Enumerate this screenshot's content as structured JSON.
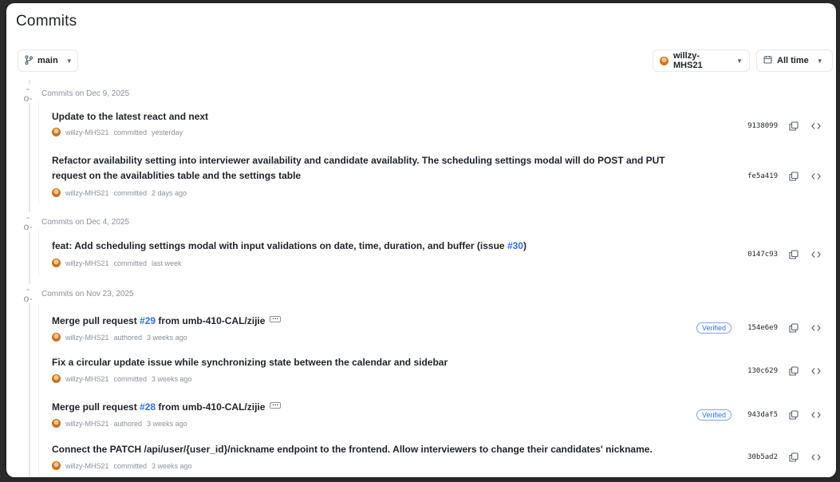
{
  "page": {
    "title": "Commits"
  },
  "toolbar": {
    "branch_label": "main",
    "author_label": "willzy-MHS21",
    "time_label": "All time"
  },
  "groups": [
    {
      "header": "Commits on Dec 9, 2025",
      "commits": [
        {
          "message": "Update to the latest react and next",
          "author": "willzy-MHS21",
          "action": "committed",
          "when": "yesterday",
          "sha": "9138099",
          "verified": false
        },
        {
          "message_line1": "Refactor availability setting into interviewer availability and candidate availablity. The scheduling settings modal will do POST and PUT",
          "message_line2": "request on the availablities table and the settings table",
          "author": "willzy-MHS21",
          "action": "committed",
          "when": "2 days ago",
          "sha": "fe5a419",
          "verified": false
        }
      ]
    },
    {
      "header": "Commits on Dec 4, 2025",
      "commits": [
        {
          "message_before": "feat: Add scheduling settings modal with input validations on date, time, duration, and buffer (issue ",
          "issue": "#30",
          "message_after": ")",
          "author": "willzy-MHS21",
          "action": "committed",
          "when": "last week",
          "sha": "0147c93",
          "verified": false
        }
      ]
    },
    {
      "header": "Commits on Nov 23, 2025",
      "commits": [
        {
          "message_before": "Merge pull request ",
          "issue": "#29",
          "message_after": " from umb-410-CAL/zijie",
          "author": "willzy-MHS21",
          "action": "authored",
          "when": "3 weeks ago",
          "sha": "154e6e9",
          "verified": true,
          "verified_label": "Verified"
        },
        {
          "message": "Fix a circular update issue while synchronizing state between the calendar and sidebar",
          "author": "willzy-MHS21",
          "action": "committed",
          "when": "3 weeks ago",
          "sha": "130c629",
          "verified": false
        },
        {
          "message_before": "Merge pull request ",
          "issue": "#28",
          "message_after": " from umb-410-CAL/zijie",
          "author": "willzy-MHS21",
          "action": "authored",
          "when": "3 weeks ago",
          "sha": "943daf5",
          "verified": true,
          "verified_label": "Verified"
        },
        {
          "message": "Connect the PATCH /api/user/{user_id}/nickname endpoint to the frontend. Allow interviewers to change their candidates' nickname.",
          "author": "willzy-MHS21",
          "action": "committed",
          "when": "3 weeks ago",
          "sha": "30b5ad2",
          "verified": false
        }
      ]
    }
  ],
  "icons": {
    "branch": "git-branch-icon",
    "calendar": "calendar-icon",
    "copy": "copy-icon",
    "browse": "code-brackets-icon",
    "commit": "git-commit-icon"
  },
  "colors": {
    "link": "#2f6feb",
    "muted": "#8a929a",
    "text": "#1f2328"
  }
}
